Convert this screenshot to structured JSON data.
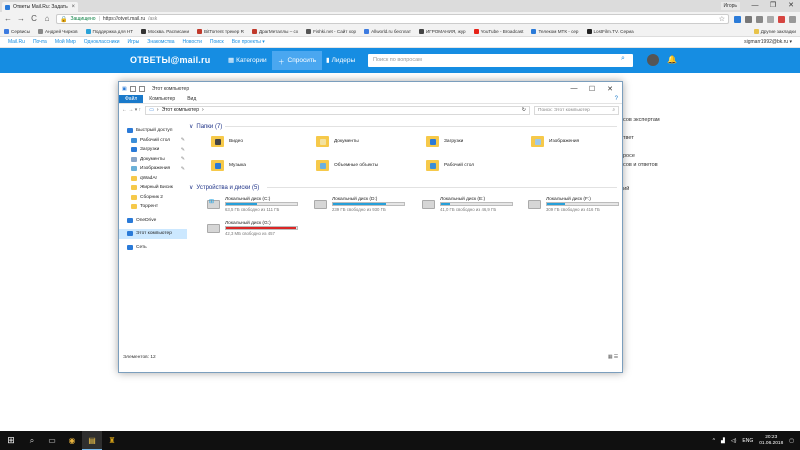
{
  "browser": {
    "tab_title": "Ответы Mail.Ru: Задать",
    "tab_close": "×",
    "profile_name": "Игорь",
    "window_controls": [
      "—",
      "❐",
      "✕"
    ],
    "nav": [
      "←",
      "→",
      "C",
      "⌂"
    ],
    "url_secure_label": "Защищено",
    "url_sep": "|",
    "url_host": "https://otvet.mail.ru",
    "url_path": "/ask",
    "star": "☆",
    "extensions": [
      "#2b7bd8",
      "#777777",
      "#888888",
      "#aaaaaa",
      "#d64541",
      "#999999"
    ],
    "bookmarks": [
      {
        "label": "Сервисы",
        "color": "#3d7be0"
      },
      {
        "label": "Андрей Чирков",
        "color": "#888888"
      },
      {
        "label": "Поддержка для НТ",
        "color": "#2aa2d8"
      },
      {
        "label": "Москва. Расписани",
        "color": "#333333"
      },
      {
        "label": "BitTorrent трекер R",
        "color": "#c0392b"
      },
      {
        "label": "ДрагМеталлы – сх",
        "color": "#c0392b"
      },
      {
        "label": "Fishki.net - Сайт хор",
        "color": "#555555"
      },
      {
        "label": "Allworld.ru бесплат",
        "color": "#3d7be0"
      },
      {
        "label": "ИГРОМАНИЯ, жур",
        "color": "#444444"
      },
      {
        "label": "YouTube - Broadcast",
        "color": "#e62117"
      },
      {
        "label": "Телеком МТК - сер",
        "color": "#2a7ad8"
      },
      {
        "label": "LostFilm.TV. Сериа",
        "color": "#222222"
      }
    ],
    "other_bookmarks": "Другие закладки"
  },
  "mailbar": {
    "links": [
      "Mail.Ru",
      "Почта",
      "Мой Мир",
      "Одноклассники",
      "Игры",
      "Знакомства",
      "Новости",
      "Поиск",
      "Все проекты ▾"
    ],
    "email": "sigmarr1992@bk.ru ▾"
  },
  "answers": {
    "logo": "ОТВЕТЫ@mail.ru",
    "categories": "Категории",
    "ask": "Спросить",
    "leaders": "Лидеры",
    "search_placeholder": "Поиск по вопросам",
    "search_icon": "⌕",
    "bell_icon": "🔔",
    "side": [
      "осов экспертам",
      "ответ",
      "просе",
      "осов и ответов",
      "ций"
    ]
  },
  "explorer": {
    "title": "Этот компьютер",
    "controls": [
      "—",
      "☐",
      "✕"
    ],
    "ribbon_tabs": [
      "Файл",
      "Компьютер",
      "Вид"
    ],
    "ribbon_help": "?",
    "address_arrows": "←  →  ▾  ↑",
    "address_path": "Этот компьютер",
    "address_chev": "›",
    "address_refresh": "↻",
    "search_placeholder": "Поиск: Этот компьютер",
    "search_icon": "⌕",
    "nav": [
      {
        "label": "Быстрый доступ",
        "color": "#2a7ad8",
        "pin": ""
      },
      {
        "label": "Рабочий стол",
        "color": "#3b8ed8",
        "pin": "✎"
      },
      {
        "label": "Загрузки",
        "color": "#2a7ad8",
        "pin": "✎"
      },
      {
        "label": "Документы",
        "color": "#8aa6c8",
        "pin": "✎"
      },
      {
        "label": "Изображения",
        "color": "#6bb0d8",
        "pin": "✎"
      },
      {
        "label": "qWadAr",
        "color": "#f6c94a",
        "pin": ""
      },
      {
        "label": "Жирный Бисик",
        "color": "#f6c94a",
        "pin": ""
      },
      {
        "label": "Сборник 2",
        "color": "#f6c94a",
        "pin": ""
      },
      {
        "label": "Торрент",
        "color": "#f6c94a",
        "pin": ""
      },
      {
        "label": "OneDrive",
        "color": "#2a7ad8",
        "pin": ""
      },
      {
        "label": "Этот компьютер",
        "color": "#2a7ad8",
        "pin": ""
      },
      {
        "label": "Сеть",
        "color": "#2a7ad8",
        "pin": ""
      }
    ],
    "folders_header": "Папки (7)",
    "folders": [
      {
        "label": "Видео",
        "color": "#444444"
      },
      {
        "label": "Документы",
        "color": "#f3e2a0"
      },
      {
        "label": "Загрузки",
        "color": "#2a7ad8"
      },
      {
        "label": "Изображения",
        "color": "#9fc8e8"
      },
      {
        "label": "Музыка",
        "color": "#2a7ad8"
      },
      {
        "label": "Объемные объекты",
        "color": "#6ab0e0"
      },
      {
        "label": "Рабочий стол",
        "color": "#3b8ed8"
      }
    ],
    "drives_header": "Устройства и диски (5)",
    "drives": [
      {
        "name": "Локальный диск (C:)",
        "free": "63,5 ГБ свободно из 111 ГБ",
        "fill": 43,
        "full": false,
        "win": "⊞"
      },
      {
        "name": "Локальный диск (D:)",
        "free": "239 ГБ свободно из 930 ГБ",
        "fill": 74,
        "full": false,
        "win": ""
      },
      {
        "name": "Локальный диск (E:)",
        "free": "41,0 ГБ свободно из 46,9 ГБ",
        "fill": 13,
        "full": false,
        "win": ""
      },
      {
        "name": "Локальный диск (F:)",
        "free": "309 ГБ свободно из 416 ГБ",
        "fill": 26,
        "full": false,
        "win": ""
      },
      {
        "name": "Локальный диск (G:)",
        "free": "42,3 МБ свободно из 457",
        "fill": 98,
        "full": true,
        "win": ""
      }
    ],
    "status": "Элементов: 12",
    "views": "▦ ☰"
  },
  "taskbar": {
    "start": "⊞",
    "icons": [
      "⌕",
      "▭",
      "◉",
      "▤",
      "♜"
    ],
    "tray_up": "^",
    "lang": "ENG",
    "time": "20:23",
    "date": "01.06.2018",
    "volume": "◁)",
    "net": "▟"
  }
}
